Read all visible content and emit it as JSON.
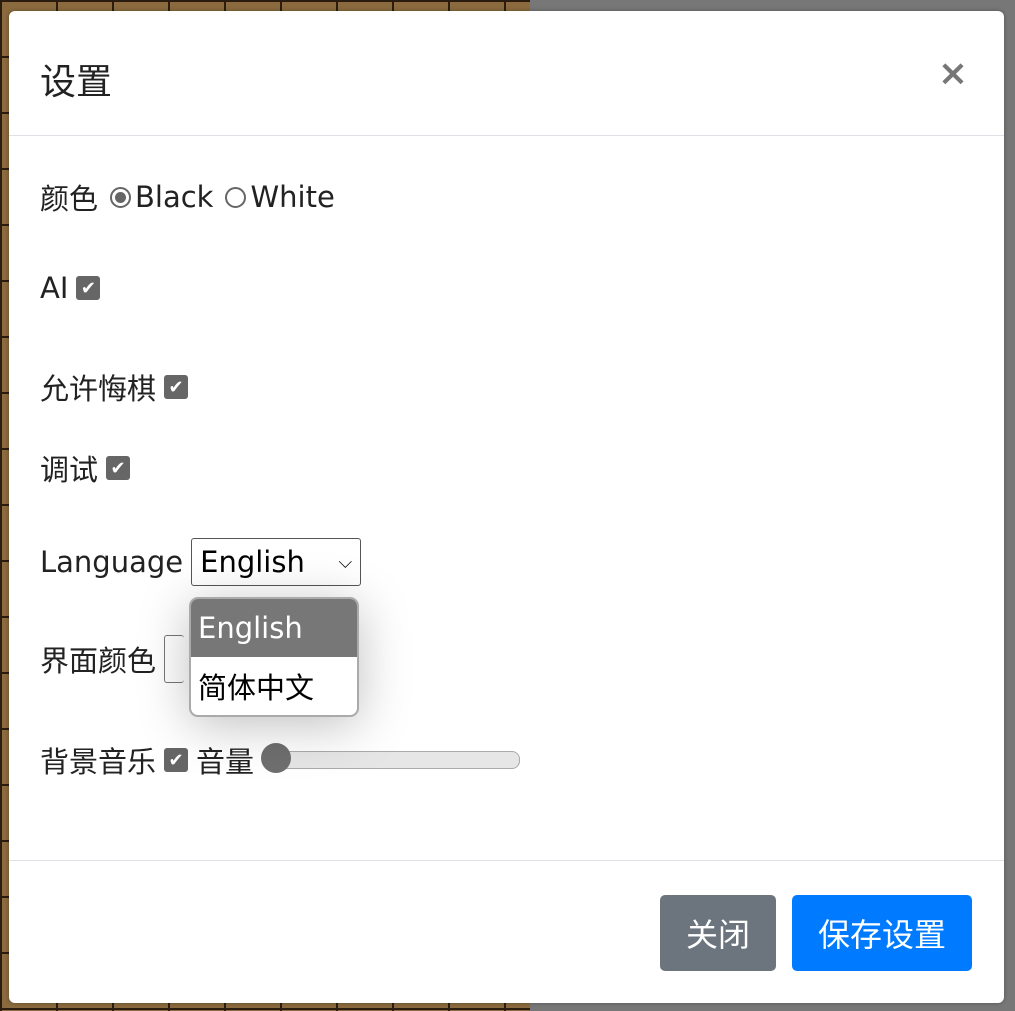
{
  "modal": {
    "title": "设置",
    "close_icon": "×",
    "color": {
      "label": "颜色",
      "options": [
        "Black",
        "White"
      ],
      "selected": "Black"
    },
    "ai": {
      "label": "AI",
      "checked": true
    },
    "undo": {
      "label": "允许悔棋",
      "checked": true
    },
    "debug": {
      "label": "调试",
      "checked": true
    },
    "language": {
      "label": "Language",
      "value": "English",
      "options": [
        "English",
        "简体中文"
      ]
    },
    "ui_color": {
      "label": "界面颜色"
    },
    "music": {
      "label": "背景音乐",
      "checked": true,
      "volume_label": "音量",
      "volume_percent": 0
    },
    "footer": {
      "close_label": "关闭",
      "save_label": "保存设置"
    },
    "check_glyph": "✔"
  }
}
